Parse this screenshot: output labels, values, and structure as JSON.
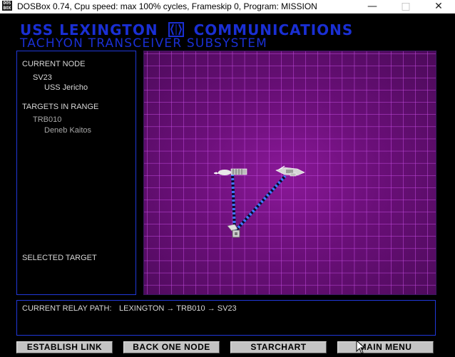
{
  "window": {
    "title": "DOSBox 0.74, Cpu speed: max 100% cycles, Frameskip  0, Program:  MISSION",
    "icon_text": "DOS BOX",
    "minimize": "—",
    "maximize": "□",
    "close": "✕"
  },
  "header": {
    "word1": "USS LEXINGTON",
    "word2": "COMMUNICATIONS",
    "subtitle": "TACHYON TRANSCEIVER SUBSYSTEM"
  },
  "info": {
    "current_node_label": "CURRENT NODE",
    "current_node_id": "SV23",
    "current_node_name": "USS Jericho",
    "targets_label": "TARGETS IN RANGE",
    "targets": [
      {
        "id": "TRB010",
        "name": "Deneb Kaitos"
      }
    ],
    "selected_target_label": "SELECTED TARGET"
  },
  "relay": {
    "label": "CURRENT RELAY PATH:",
    "path": "LEXINGTON  →  TRB010  →  SV23"
  },
  "buttons": {
    "establish": "ESTABLISH LINK",
    "back": "BACK ONE NODE",
    "starchart": "STARCHART",
    "main_menu": "MAIN MENU"
  },
  "colors": {
    "header_blue": "#1a2fd4",
    "grid_line": "#c44ce0",
    "map_bg": "#6a0f78",
    "beam_blue": "#3f7bff"
  }
}
